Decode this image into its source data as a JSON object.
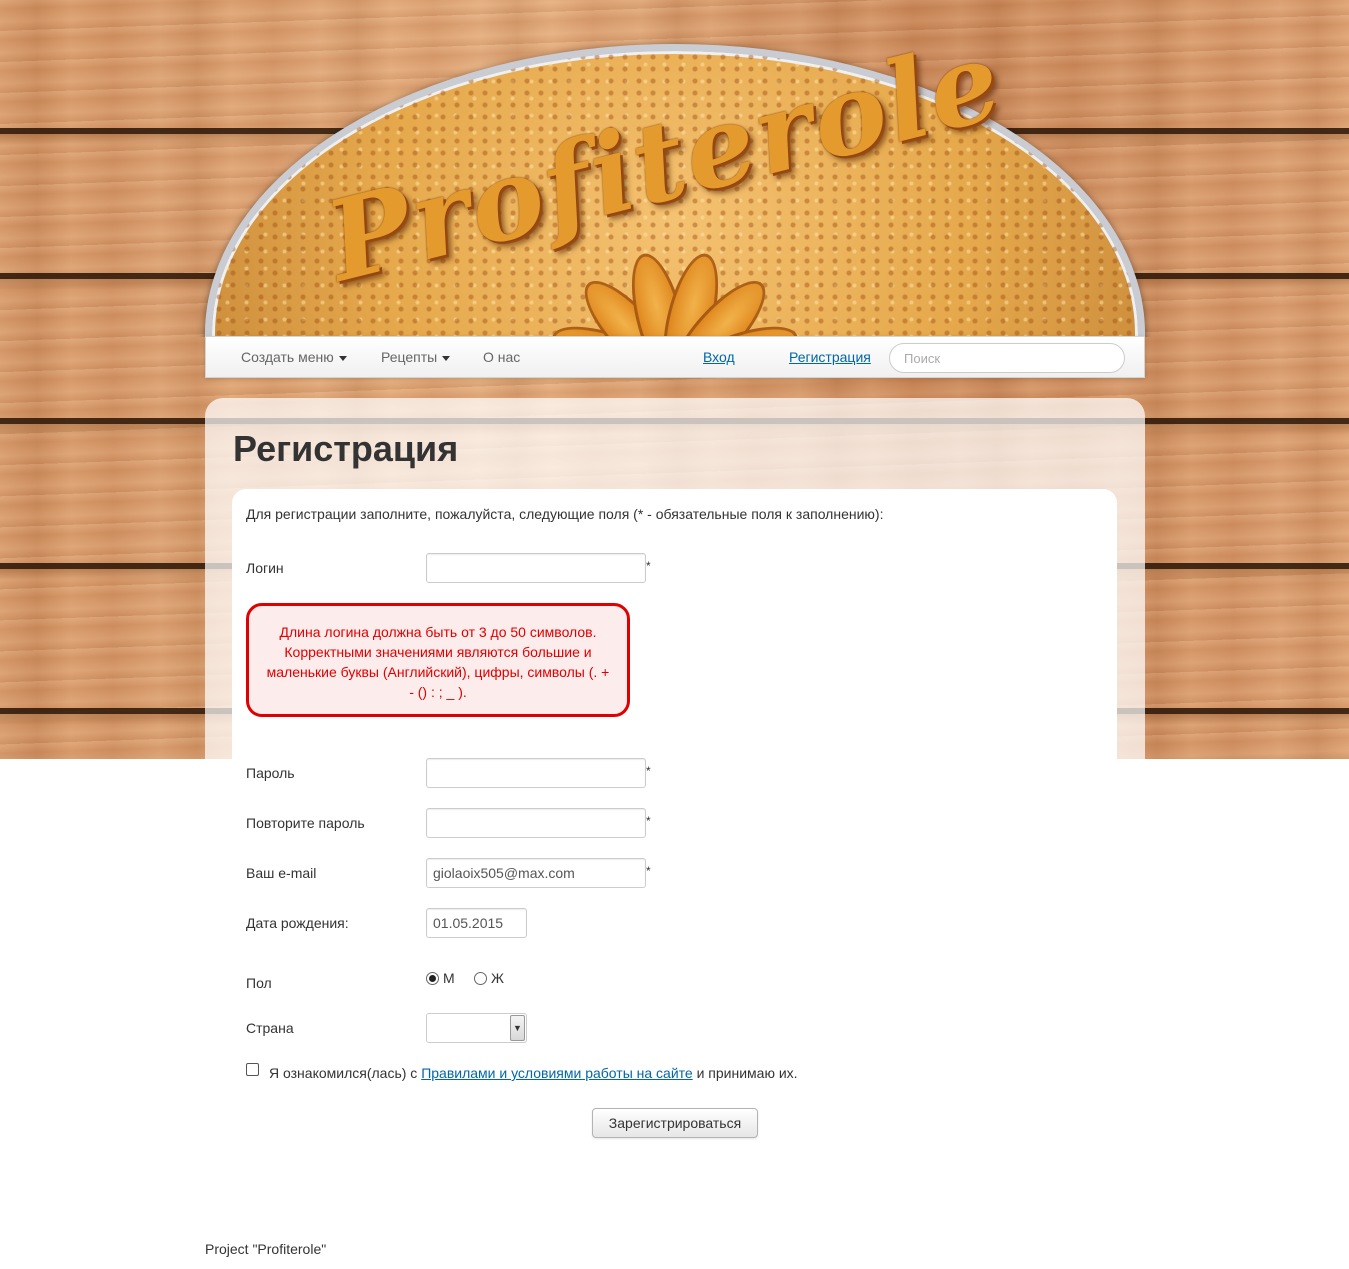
{
  "nav": {
    "items": [
      {
        "label": "Создать меню",
        "has_caret": true
      },
      {
        "label": "Рецепты",
        "has_caret": true
      },
      {
        "label": "О нас",
        "has_caret": false
      }
    ],
    "login_label": "Вход",
    "register_label": "Регистрация",
    "search_placeholder": "Поиск"
  },
  "logo": {
    "text": "Profiterole"
  },
  "page": {
    "title": "Регистрация",
    "intro": "Для регистрации заполните, пожалуйста, следующие поля (* - обязательные поля к заполнению):"
  },
  "form": {
    "login": {
      "label": "Логин",
      "value": "",
      "required_mark": "*"
    },
    "login_error": "Длина логина должна быть от 3 до 50 символов. Корректными значениями являются большие и маленькие буквы (Английский), цифры, символы (. + - () : ; _ ).",
    "password": {
      "label": "Пароль",
      "value": "",
      "required_mark": "*"
    },
    "password_repeat": {
      "label": "Повторите пароль",
      "value": "",
      "required_mark": "*"
    },
    "email": {
      "label": "Ваш e-mail",
      "value": "giolaoix505@max.com",
      "required_mark": "*"
    },
    "birth_date": {
      "label": "Дата рождения:",
      "value": "01.05.2015"
    },
    "gender": {
      "label": "Пол",
      "options": [
        "М",
        "Ж"
      ],
      "selected": "М"
    },
    "country": {
      "label": "Страна",
      "value": ""
    },
    "terms": {
      "before": "Я ознакомился(лась) с ",
      "link": "Правилами и условиями работы на сайте",
      "after": " и принимаю их.",
      "checked": false
    },
    "submit_label": "Зарегистрироваться"
  },
  "footer": {
    "text": "Project \"Profiterole\""
  },
  "colors": {
    "error": "#e00000",
    "link": "#0066aa",
    "error_bg": "#fdecec"
  }
}
